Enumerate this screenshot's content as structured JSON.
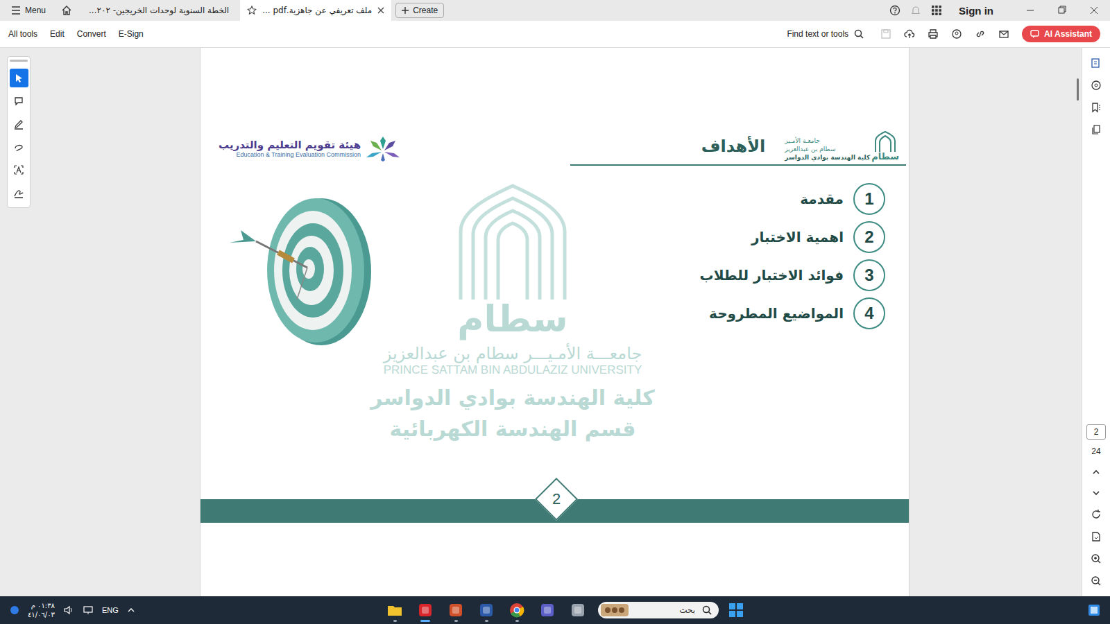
{
  "app": {
    "menu": "Menu",
    "tabs": [
      {
        "label": "الخطة السنوية لوحدات الخريجين- ٢٠٢...",
        "selected": false
      },
      {
        "label": "ملف تعريفي عن جاهزية.pdf ...",
        "selected": true
      }
    ],
    "create": "Create",
    "sign_in": "Sign in"
  },
  "toolbar": {
    "menu_items": [
      "All tools",
      "Edit",
      "Convert",
      "E-Sign"
    ],
    "find": "Find text or tools",
    "ai_button": "AI Assistant"
  },
  "tools": [
    {
      "kind": "select",
      "selected": true
    },
    {
      "kind": "comment",
      "selected": false
    },
    {
      "kind": "highlight",
      "selected": false
    },
    {
      "kind": "draw",
      "selected": false
    },
    {
      "kind": "text",
      "selected": false
    },
    {
      "kind": "sign",
      "selected": false
    }
  ],
  "page_nav": {
    "current": "2",
    "total": "24"
  },
  "slide": {
    "title": "الأهداف",
    "university_logo": {
      "mark": "سطام",
      "lines": [
        "جامعـة الأمـير",
        "سطام بن عبدالعزيز",
        "كلية الهندسة بوادي الدواسر"
      ]
    },
    "commission": {
      "name": "هيئة تقويم التعليم والتدريب",
      "english": "Education & Training Evaluation Commission"
    },
    "items": [
      {
        "number": "1",
        "label": "مقدمة"
      },
      {
        "number": "2",
        "label": "اهمية الاختبار"
      },
      {
        "number": "3",
        "label": "فوائد الاختبار للطلاب"
      },
      {
        "number": "4",
        "label": "المواضيع المطروحة"
      }
    ],
    "watermark": {
      "mark": "سطام",
      "lines": [
        "جامعـــة الأمـيـــر سطام بن عبدالعزيز",
        "PRINCE SATTAM BIN ABDULAZIZ UNIVERSITY",
        "كلية الهندسة بوادي الدواسر",
        "قسم الهندسة الكهربائية"
      ]
    },
    "page_number": "2"
  },
  "taskbar": {
    "time": "٠١:٣٨ م",
    "date": "٤١/٠٦/٠٣",
    "language": "ENG",
    "search": "بحث",
    "apps": [
      {
        "kind": "explorer",
        "running": true,
        "active": false
      },
      {
        "kind": "acrobat",
        "running": true,
        "active": true
      },
      {
        "kind": "powerpoint",
        "running": true,
        "active": false
      },
      {
        "kind": "word",
        "running": true,
        "active": false
      },
      {
        "kind": "chrome",
        "running": true,
        "active": false
      },
      {
        "kind": "teams",
        "running": false,
        "active": false
      },
      {
        "kind": "window",
        "running": false,
        "active": false
      }
    ]
  }
}
